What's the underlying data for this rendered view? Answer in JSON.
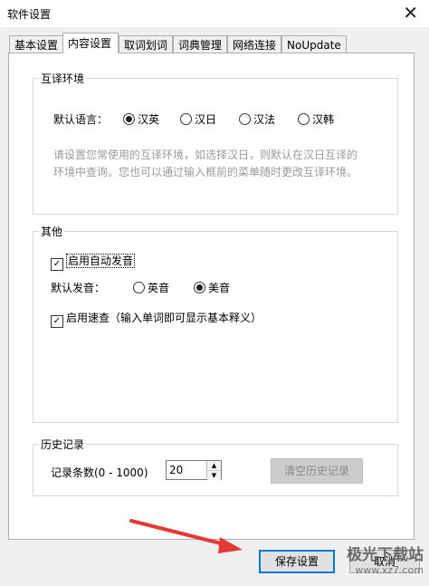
{
  "window": {
    "title": "软件设置",
    "close_glyph": "✕"
  },
  "tabs": [
    {
      "label": "基本设置",
      "active": false
    },
    {
      "label": "内容设置",
      "active": true
    },
    {
      "label": "取词划词",
      "active": false
    },
    {
      "label": "词典管理",
      "active": false
    },
    {
      "label": "网络连接",
      "active": false
    },
    {
      "label": "NoUpdate",
      "active": false
    }
  ],
  "translate_env": {
    "title": "互译环境",
    "default_lang_label": "默认语言：",
    "options": [
      {
        "label": "汉英",
        "selected": true
      },
      {
        "label": "汉日",
        "selected": false
      },
      {
        "label": "汉法",
        "selected": false
      },
      {
        "label": "汉韩",
        "selected": false
      }
    ],
    "hint": "请设置您常使用的互译环境，如选择汉日，则默认在汉日互译的环境中查询。您也可以通过输入框前的菜单随时更改互译环境。"
  },
  "other": {
    "title": "其他",
    "auto_pronounce": {
      "label": "启用自动发音",
      "checked": true
    },
    "default_pron_label": "默认发音：",
    "pron_options": [
      {
        "label": "英音",
        "selected": false
      },
      {
        "label": "美音",
        "selected": true
      }
    ],
    "quick_lookup": {
      "label": "启用速查（输入单词即可显示基本释义）",
      "checked": true
    }
  },
  "history": {
    "title": "历史记录",
    "count_label": "记录条数(0 - 1000)",
    "count_value": "20",
    "clear_button": "清空历史记录"
  },
  "footer": {
    "save_button": "保存设置",
    "cancel_button": "取消",
    "watermark_brand": "极光下载站",
    "watermark_url": "www.xz7.com"
  },
  "icons": {
    "check": "✓",
    "spin_up": "▲",
    "spin_down": "▼"
  },
  "colors": {
    "primary_border": "#0078d7",
    "arrow": "#e53935"
  }
}
